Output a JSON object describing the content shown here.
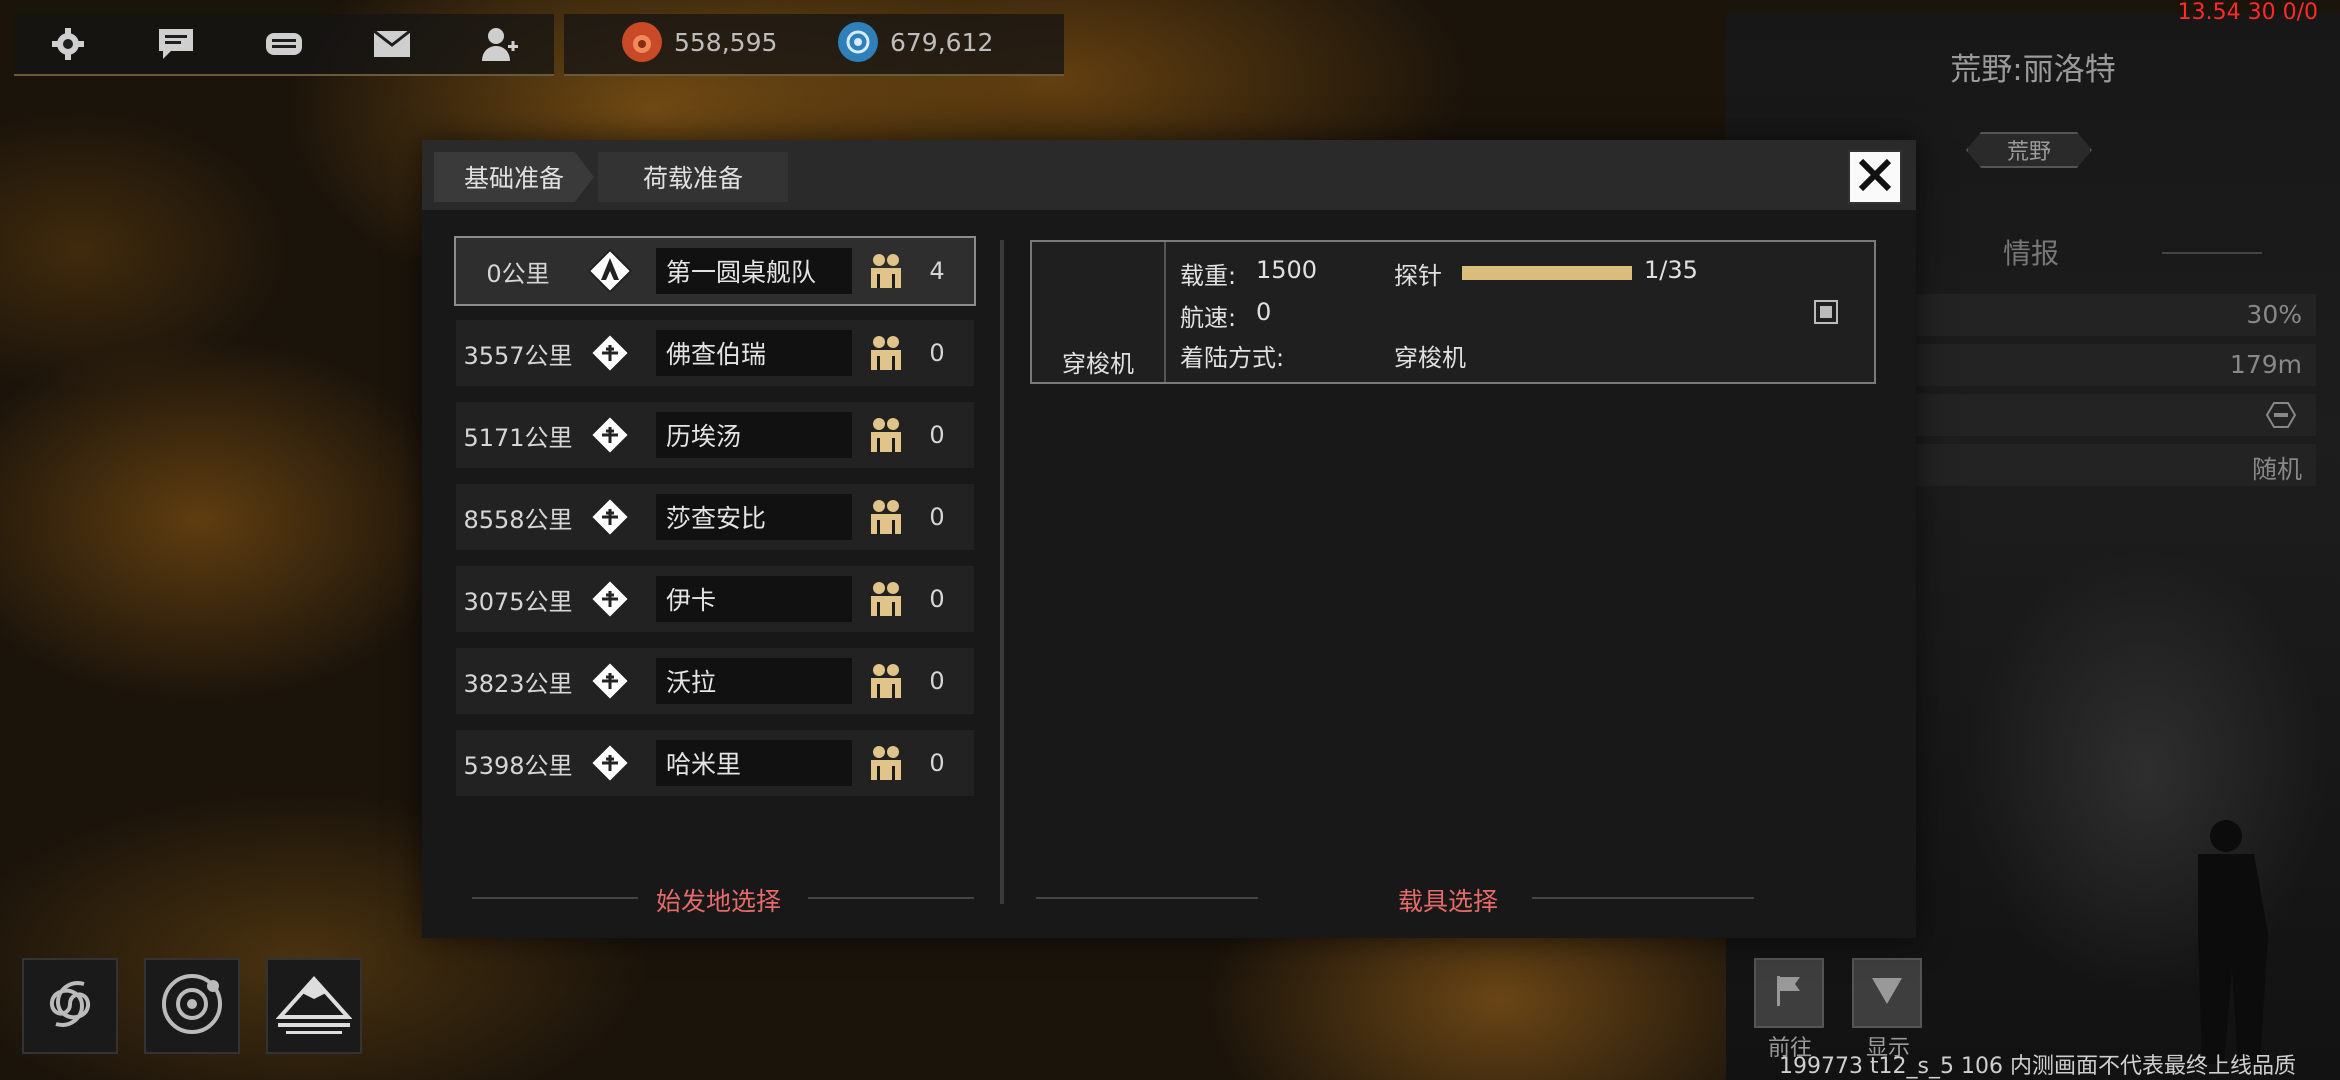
{
  "topbar": {
    "icons": [
      "gear-icon",
      "chat-icon",
      "gamepad-icon",
      "mail-icon",
      "friends-icon"
    ],
    "resources": [
      {
        "icon": "red-resource-icon",
        "value": "558,595",
        "color": "#d2552e"
      },
      {
        "icon": "blue-resource-icon",
        "value": "679,612",
        "color": "#3c8fc9"
      }
    ]
  },
  "debug": {
    "fps": "13.54 30 0/0"
  },
  "right_panel": {
    "title": "荒野:丽洛特",
    "badge": "荒野",
    "section": "情报",
    "stats": [
      "30%",
      "179m",
      "",
      "随机"
    ],
    "buttons": [
      {
        "label": "前往",
        "icon": "flag-icon"
      },
      {
        "label": "显示",
        "icon": "triangle-down-icon"
      }
    ]
  },
  "modal": {
    "tabs": [
      "基础准备",
      "荷载准备"
    ],
    "start_list": [
      {
        "distance": "0公里",
        "name": "第一圆桌舰队",
        "count": "4",
        "selected": true
      },
      {
        "distance": "3557公里",
        "name": "佛查伯瑞",
        "count": "0",
        "selected": false
      },
      {
        "distance": "5171公里",
        "name": "历埃汤",
        "count": "0",
        "selected": false
      },
      {
        "distance": "8558公里",
        "name": "莎查安比",
        "count": "0",
        "selected": false
      },
      {
        "distance": "3075公里",
        "name": "伊卡",
        "count": "0",
        "selected": false
      },
      {
        "distance": "3823公里",
        "name": "沃拉",
        "count": "0",
        "selected": false
      },
      {
        "distance": "5398公里",
        "name": "哈米里",
        "count": "0",
        "selected": false
      }
    ],
    "start_label": "始发地选择",
    "vehicle": {
      "name": "穿梭机",
      "load_label": "载重:",
      "load_value": "1500",
      "probe_label": "探针",
      "probe_value": "1/35",
      "probe_fill": 1.0,
      "speed_label": "航速:",
      "speed_value": "0",
      "landing_label": "着陆方式:",
      "landing_value": "穿梭机"
    },
    "vehicle_label": "载具选择"
  },
  "footer": {
    "build": "199773 t12_s_5 106 内测画面不代表最终上线品质"
  },
  "colors": {
    "accent": "#e56a6a",
    "gold": "#d9bd7a"
  }
}
